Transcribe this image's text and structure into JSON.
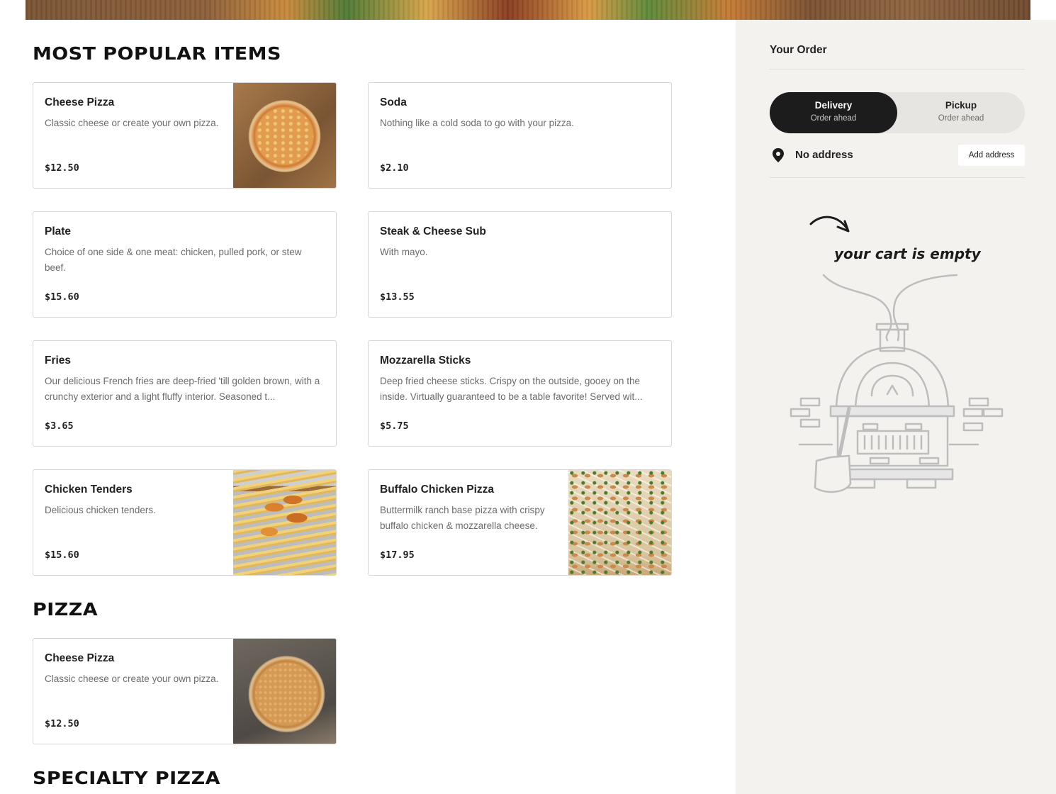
{
  "menu": {
    "sections": [
      {
        "title": "MOST POPULAR ITEMS"
      },
      {
        "title": "PIZZA"
      },
      {
        "title": "SPECIALTY PIZZA"
      }
    ],
    "popular": [
      {
        "name": "Cheese Pizza",
        "description": "Classic cheese or create your own pizza.",
        "price": "$12.50"
      },
      {
        "name": "Soda",
        "description": "Nothing like a cold soda to go with your pizza.",
        "price": "$2.10"
      },
      {
        "name": "Plate",
        "description": "Choice of one side & one meat: chicken, pulled pork, or stew beef.",
        "price": "$15.60"
      },
      {
        "name": "Steak & Cheese Sub",
        "description": "With mayo.",
        "price": "$13.55"
      },
      {
        "name": "Fries",
        "description": "Our delicious French fries are deep-fried 'till golden brown, with a crunchy exterior and a light fluffy interior. Seasoned t...",
        "price": "$3.65"
      },
      {
        "name": "Mozzarella Sticks",
        "description": "Deep fried cheese sticks. Crispy on the outside, gooey on the inside. Virtually guaranteed to be a table favorite! Served wit...",
        "price": "$5.75"
      },
      {
        "name": "Chicken Tenders",
        "description": "Delicious chicken tenders.",
        "price": "$15.60"
      },
      {
        "name": "Buffalo Chicken Pizza",
        "description": "Buttermilk ranch base pizza with crispy buffalo chicken & mozzarella cheese.",
        "price": "$17.95"
      }
    ],
    "pizza": [
      {
        "name": "Cheese Pizza",
        "description": "Classic cheese or create your own pizza.",
        "price": "$12.50"
      }
    ]
  },
  "order": {
    "title": "Your Order",
    "delivery": {
      "label": "Delivery",
      "sub": "Order ahead"
    },
    "pickup": {
      "label": "Pickup",
      "sub": "Order ahead"
    },
    "address_text": "No address",
    "add_address_label": "Add address",
    "empty_cart_text": "your cart is empty",
    "icons": {
      "location": "location-pin-icon",
      "arrow": "curved-arrow-icon",
      "oven": "pizza-oven-illustration"
    }
  }
}
